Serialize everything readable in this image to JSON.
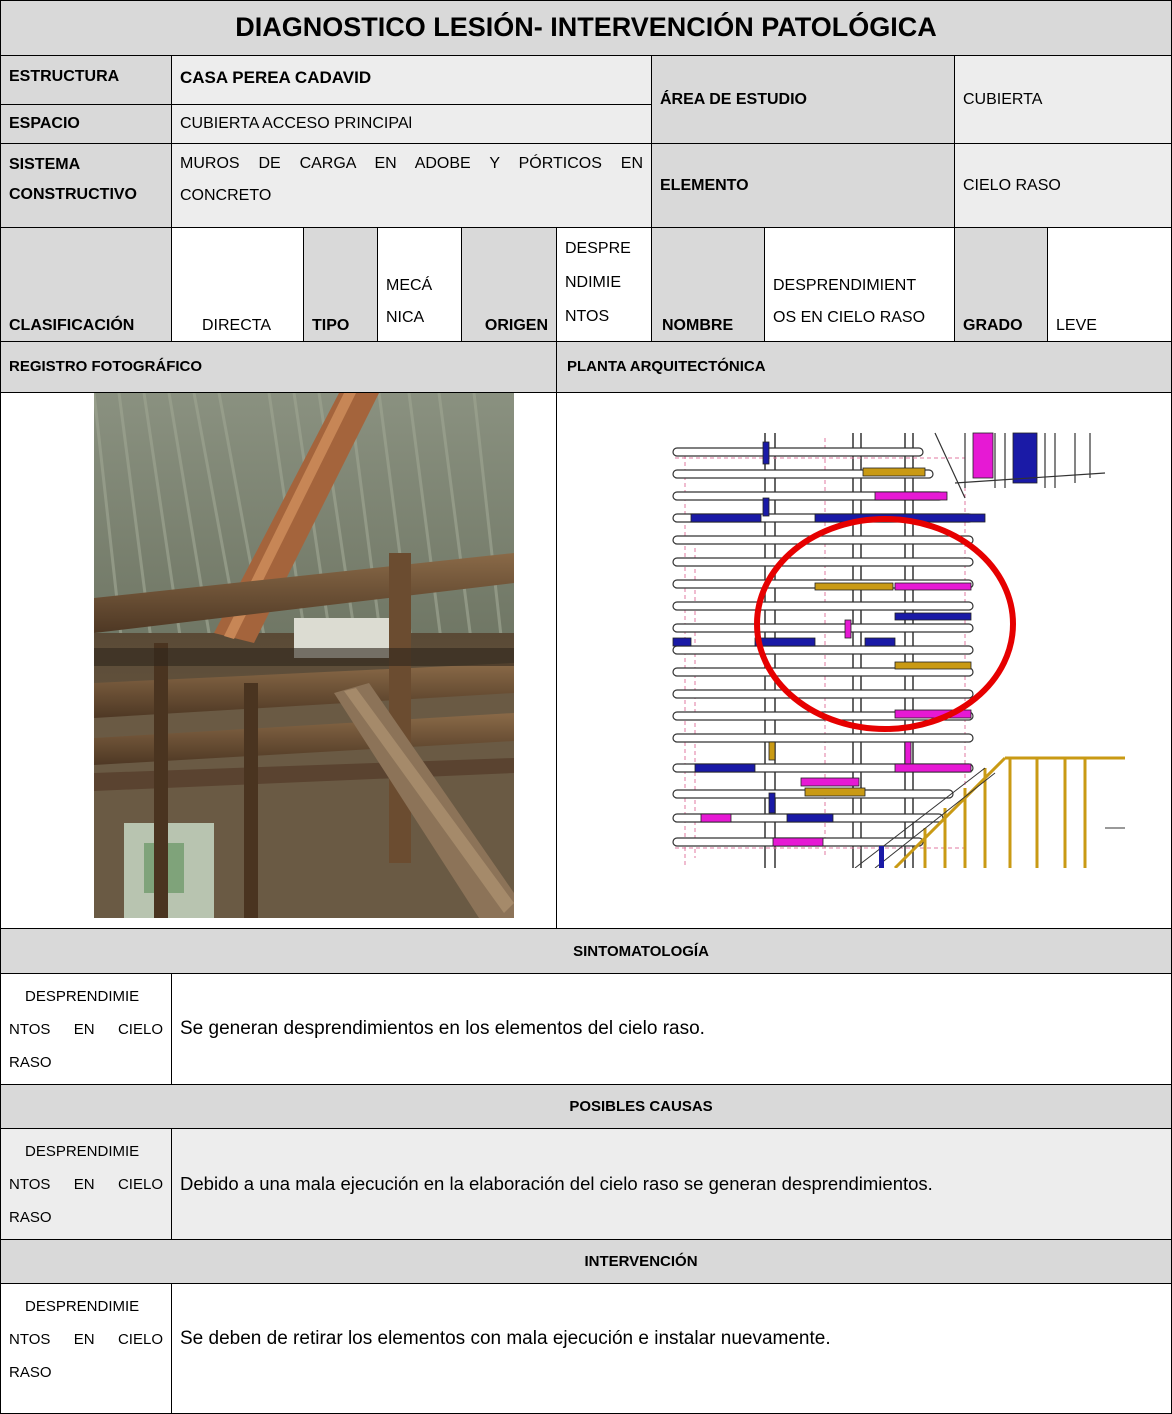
{
  "title": "DIAGNOSTICO LESIÓN- INTERVENCIÓN PATOLÓGICA",
  "structure": {
    "label": "ESTRUCTURA",
    "value": "CASA PEREA CADAVID"
  },
  "space": {
    "label": "ESPACIO",
    "value": "CUBIERTA ACCESO PRINCIPAl"
  },
  "study_area": {
    "label": "ÁREA DE ESTUDIO",
    "value": "CUBIERTA"
  },
  "system": {
    "label_line1": "SISTEMA",
    "label_line2": "CONSTRUCTIVO",
    "value_line1": "MUROS DE CARGA EN ADOBE Y PÓRTICOS EN",
    "value_line2": "CONCRETO"
  },
  "element": {
    "label": "ELEMENTO",
    "value": "CIELO RASO"
  },
  "classification": {
    "label": "CLASIFICACIÓN",
    "value": "DIRECTA",
    "type_label": "TIPO",
    "type_lines": [
      "MECÁ",
      "NICA"
    ],
    "origin_label": "ORIGEN",
    "origin_lines": [
      "DESPRE",
      "NDIMIE",
      "NTOS"
    ],
    "name_label": "NOMBRE",
    "name_lines": [
      "DESPRENDIMIENT",
      "OS EN CIELO RASO"
    ],
    "grade_label": "GRADO",
    "grade_value": "LEVE"
  },
  "photo_section": {
    "label": "REGISTRO FOTOGRÁFICO"
  },
  "plan_section": {
    "label": "PLANTA ARQUITECTÓNICA"
  },
  "symptoms": {
    "header": "SINTOMATOLOGÍA",
    "label_lines": [
      "DESPRENDIMIE",
      "NTOS EN CIELO",
      "RASO"
    ],
    "text": "Se generan desprendimientos en los elementos del cielo raso."
  },
  "causes": {
    "header": "POSIBLES CAUSAS",
    "label_lines": [
      "DESPRENDIMIE",
      "NTOS EN CIELO",
      "RASO"
    ],
    "text": "Debido a una mala ejecución en la elaboración del cielo raso se generan desprendimientos."
  },
  "intervention": {
    "header": "INTERVENCIÓN",
    "label_lines": [
      "DESPRENDIMIE",
      "NTOS EN CIELO",
      "RASO"
    ],
    "text": "Se deben de retirar los elementos con mala ejecución e instalar nuevamente."
  },
  "colors": {
    "header_gray": "#d9d9d9",
    "light_gray": "#ededed",
    "plan_blue": "#1a1aa6",
    "plan_magenta": "#e619d4",
    "plan_gold": "#c99a14",
    "highlight_red": "#e60000"
  }
}
